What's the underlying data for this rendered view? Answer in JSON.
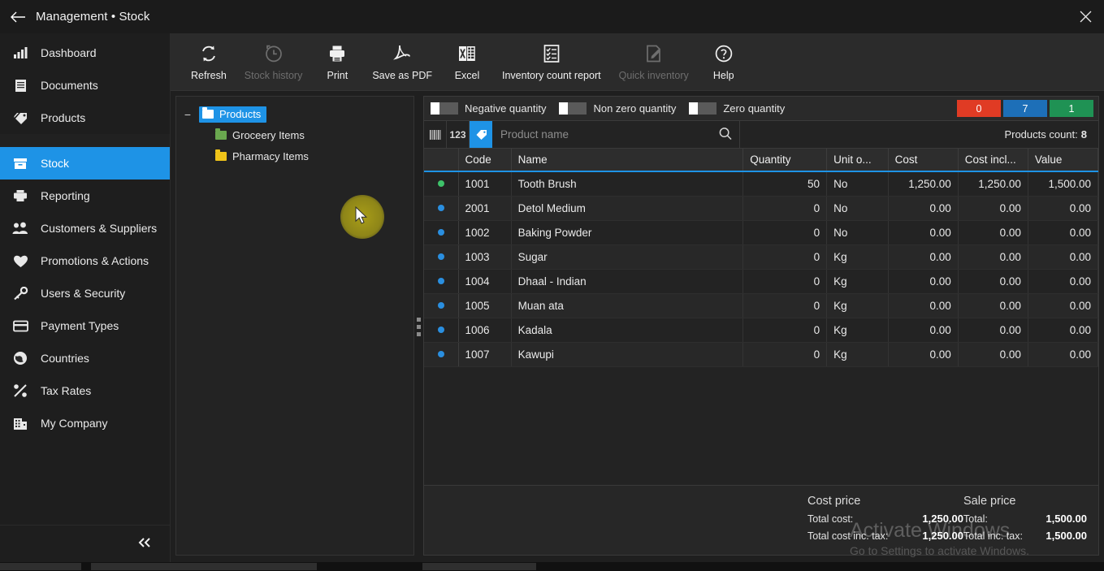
{
  "window": {
    "title": "Management • Stock",
    "back_icon": "arrow-left-icon",
    "close_icon": "close-icon"
  },
  "sidebar": {
    "items": [
      {
        "label": "Dashboard",
        "icon": "bar-chart-icon",
        "state": "normal"
      },
      {
        "label": "Documents",
        "icon": "document-icon",
        "state": "normal"
      },
      {
        "label": "Products",
        "icon": "tag-icon",
        "state": "normal"
      },
      {
        "label": "",
        "icon": "blank-icon",
        "state": "ghost"
      },
      {
        "label": "Stock",
        "icon": "box-icon",
        "state": "active"
      },
      {
        "label": "Reporting",
        "icon": "printer-icon",
        "state": "normal"
      },
      {
        "label": "Customers & Suppliers",
        "icon": "people-icon",
        "state": "normal"
      },
      {
        "label": "Promotions & Actions",
        "icon": "heart-icon",
        "state": "normal"
      },
      {
        "label": "Users & Security",
        "icon": "key-icon",
        "state": "normal"
      },
      {
        "label": "Payment Types",
        "icon": "credit-card-icon",
        "state": "normal"
      },
      {
        "label": "Countries",
        "icon": "globe-icon",
        "state": "normal"
      },
      {
        "label": "Tax Rates",
        "icon": "percent-icon",
        "state": "normal"
      },
      {
        "label": "My Company",
        "icon": "building-icon",
        "state": "normal"
      }
    ],
    "collapse_icon": "chevron-double-left-icon"
  },
  "toolbar": {
    "buttons": [
      {
        "label": "Refresh",
        "icon": "refresh-icon",
        "disabled": false
      },
      {
        "label": "Stock history",
        "icon": "clock-history-icon",
        "disabled": true
      },
      {
        "label": "Print",
        "icon": "printer-icon",
        "disabled": false
      },
      {
        "label": "Save as PDF",
        "icon": "pdf-icon",
        "disabled": false
      },
      {
        "label": "Excel",
        "icon": "excel-icon",
        "disabled": false
      },
      {
        "label": "Inventory count report",
        "icon": "checklist-icon",
        "disabled": false
      },
      {
        "label": "Quick inventory",
        "icon": "edit-note-icon",
        "disabled": true
      },
      {
        "label": "Help",
        "icon": "question-circle-icon",
        "disabled": false
      }
    ]
  },
  "tree": {
    "root": {
      "label": "Products",
      "twisty": "−",
      "folder_color": "#ffffff",
      "selected": true
    },
    "children": [
      {
        "label": "Groceery Items",
        "folder_color": "#6aa84f"
      },
      {
        "label": "Pharmacy Items",
        "folder_color": "#f0c419"
      }
    ]
  },
  "filters": {
    "toggles": [
      {
        "label": "Negative quantity",
        "on": false
      },
      {
        "label": "Non zero quantity",
        "on": false
      },
      {
        "label": "Zero quantity",
        "on": false
      }
    ],
    "badges": [
      {
        "value": "0",
        "color": "#e03b24"
      },
      {
        "value": "7",
        "color": "#1d6fb8"
      },
      {
        "value": "1",
        "color": "#1f9254"
      }
    ]
  },
  "search": {
    "barcode_icon": "barcode-icon",
    "number_label": "123",
    "tag_icon": "tag-icon",
    "placeholder": "Product name",
    "value": "",
    "search_icon": "search-icon",
    "count_label": "Products count:",
    "count_value": "8"
  },
  "table": {
    "columns": [
      "",
      "Code",
      "Name",
      "Quantity",
      "Unit o...",
      "Cost",
      "Cost incl...",
      "Value"
    ],
    "rows": [
      {
        "dot": "#3ec26a",
        "code": "1001",
        "name": "Tooth Brush",
        "quantity": "50",
        "unit": "No",
        "cost": "1,250.00",
        "cost_incl": "1,250.00",
        "value": "1,500.00"
      },
      {
        "dot": "#2a8fe0",
        "code": "2001",
        "name": "Detol Medium",
        "quantity": "0",
        "unit": "No",
        "cost": "0.00",
        "cost_incl": "0.00",
        "value": "0.00"
      },
      {
        "dot": "#2a8fe0",
        "code": "1002",
        "name": "Baking Powder",
        "quantity": "0",
        "unit": "No",
        "cost": "0.00",
        "cost_incl": "0.00",
        "value": "0.00"
      },
      {
        "dot": "#2a8fe0",
        "code": "1003",
        "name": "Sugar",
        "quantity": "0",
        "unit": "Kg",
        "cost": "0.00",
        "cost_incl": "0.00",
        "value": "0.00"
      },
      {
        "dot": "#2a8fe0",
        "code": "1004",
        "name": "Dhaal - Indian",
        "quantity": "0",
        "unit": "Kg",
        "cost": "0.00",
        "cost_incl": "0.00",
        "value": "0.00"
      },
      {
        "dot": "#2a8fe0",
        "code": "1005",
        "name": "Muan ata",
        "quantity": "0",
        "unit": "Kg",
        "cost": "0.00",
        "cost_incl": "0.00",
        "value": "0.00"
      },
      {
        "dot": "#2a8fe0",
        "code": "1006",
        "name": "Kadala",
        "quantity": "0",
        "unit": "Kg",
        "cost": "0.00",
        "cost_incl": "0.00",
        "value": "0.00"
      },
      {
        "dot": "#2a8fe0",
        "code": "1007",
        "name": "Kawupi",
        "quantity": "0",
        "unit": "Kg",
        "cost": "0.00",
        "cost_incl": "0.00",
        "value": "0.00"
      }
    ]
  },
  "footer": {
    "cost": {
      "heading": "Cost price",
      "total_label": "Total cost:",
      "total_value": "1,250.00",
      "total_tax_label": "Total cost inc. tax:",
      "total_tax_value": "1,250.00"
    },
    "sale": {
      "heading": "Sale price",
      "total_label": "Total:",
      "total_value": "1,500.00",
      "total_tax_label": "Total inc. tax:",
      "total_tax_value": "1,500.00"
    }
  },
  "watermark": {
    "line1": "Activate Windows",
    "line2": "Go to Settings to activate Windows."
  }
}
